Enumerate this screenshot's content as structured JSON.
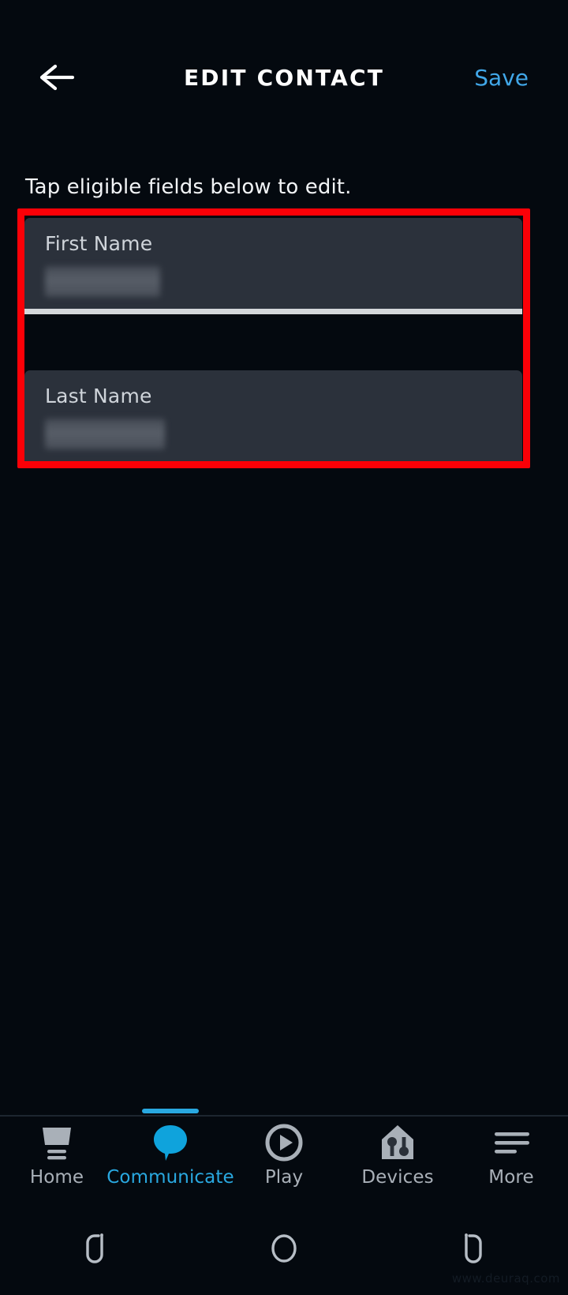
{
  "header": {
    "back_icon": "arrow-left-icon",
    "title": "EDIT CONTACT",
    "save_label": "Save",
    "save_color": "#41a7e8"
  },
  "main": {
    "instruction": "Tap eligible fields below to edit.",
    "highlight_color": "#fb0007",
    "fields": [
      {
        "label": "First Name",
        "value": "",
        "redacted": true
      },
      {
        "label": "Last Name",
        "value": "",
        "redacted": true
      }
    ]
  },
  "tabbar": {
    "active_index": 1,
    "active_color": "#29a8e0",
    "inactive_color": "#a9b0b8",
    "items": [
      {
        "label": "Home",
        "icon": "monitor-icon"
      },
      {
        "label": "Communicate",
        "icon": "speech-bubble-icon"
      },
      {
        "label": "Play",
        "icon": "play-circle-icon"
      },
      {
        "label": "Devices",
        "icon": "smart-home-icon"
      },
      {
        "label": "More",
        "icon": "hamburger-menu-icon"
      }
    ]
  },
  "system_nav": {
    "items": [
      {
        "icon": "recents-icon"
      },
      {
        "icon": "home-circle-icon"
      },
      {
        "icon": "back-icon"
      }
    ]
  },
  "watermark": "www.deuraq.com"
}
